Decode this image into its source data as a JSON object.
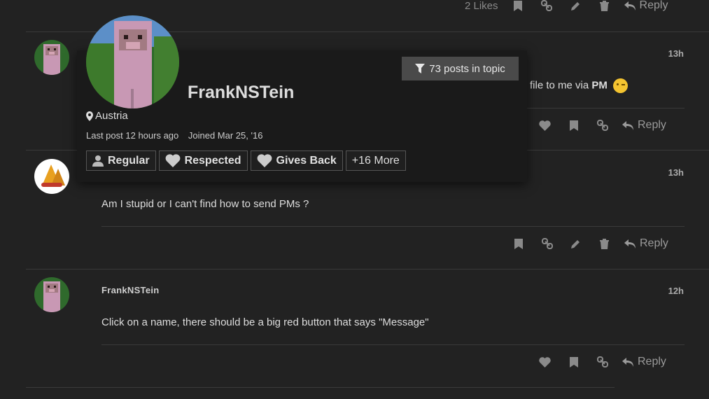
{
  "top_post": {
    "likes_label": "2 Likes",
    "reply_label": "Reply"
  },
  "post1": {
    "time": "13h",
    "text_visible": "file to me via",
    "text_bold": "PM",
    "reply_label": "Reply"
  },
  "post2": {
    "time": "13h",
    "text": "Am I stupid or I can't find how to send PMs ?",
    "reply_label": "Reply"
  },
  "post3": {
    "username": "FrankNSTein",
    "time": "12h",
    "text": "Click on a name, there should be a big red button that says \"Message\"",
    "reply_label": "Reply"
  },
  "user_card": {
    "name": "FrankNSTein",
    "filter_label": "73 posts in topic",
    "location": "Austria",
    "last_post": "Last post 12 hours ago",
    "joined": "Joined Mar 25, '16",
    "badges": [
      "Regular",
      "Respected",
      "Gives Back"
    ],
    "more_badges": "+16 More"
  },
  "icons": {
    "bookmark": "bookmark-icon",
    "link": "link-icon",
    "edit": "pencil-icon",
    "delete": "trash-icon",
    "like": "heart-icon",
    "reply": "reply-icon",
    "filter": "filter-icon",
    "location": "map-marker-icon",
    "badge_user": "user-icon",
    "badge_heart": "heart-icon"
  },
  "colors": {
    "background": "#222222",
    "card_background": "#1a1a1a",
    "filter_button": "#4a4a4a",
    "icon_gray": "#8a8a8a"
  }
}
